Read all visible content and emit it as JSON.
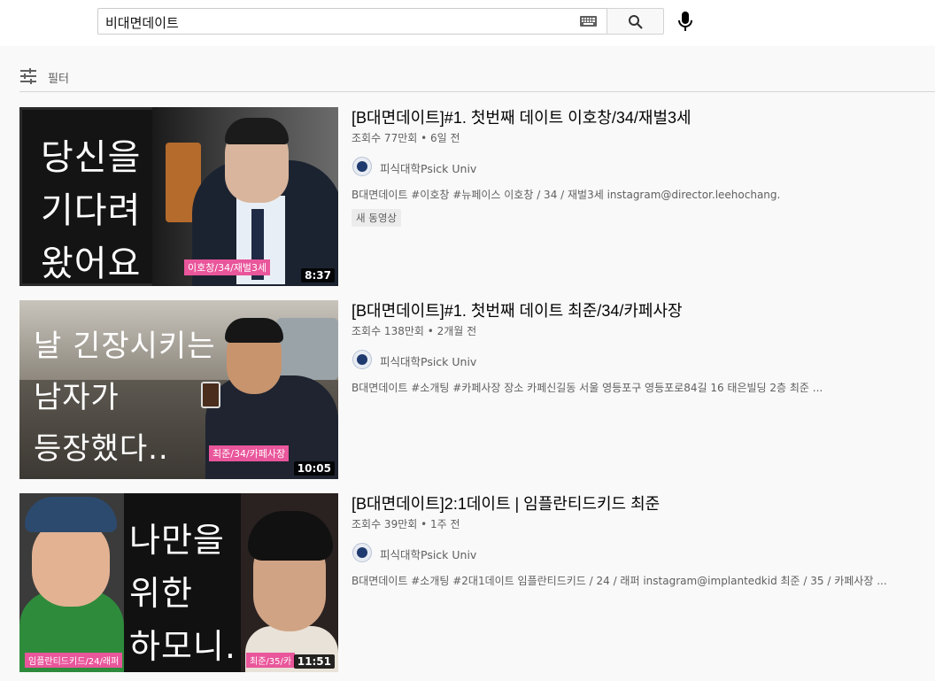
{
  "search": {
    "query": "비대면데이트"
  },
  "filter": {
    "label": "필터"
  },
  "videos": [
    {
      "title": "[B대면데이트]#1. 첫번째 데이트 이호창/34/재벌3세",
      "stats": "조회수 77만회 • 6일 전",
      "channel": "피식대학Psick Univ",
      "description": "B대면데이트 #이호창 #뉴페이스 이호창 / 34 / 재벌3세 instagram@director.leehochang.",
      "badge": "새 동영상",
      "duration": "8:37",
      "thumb_lines": [
        "당신을",
        "기다려",
        "왔어요"
      ],
      "thumb_tag": "이호창/34/재벌3세"
    },
    {
      "title": "[B대면데이트]#1. 첫번째 데이트 최준/34/카페사장",
      "stats": "조회수 138만회 • 2개월 전",
      "channel": "피식대학Psick Univ",
      "description": "B대면데이트 #소개팅 #카페사장 장소 카페신길동 서울 영등포구 영등포로84길 16 태은빌딩 2층 최준 ...",
      "duration": "10:05",
      "thumb_lines": [
        "날 긴장시키는",
        "남자가",
        "등장했다.."
      ],
      "thumb_tag": "최준/34/카페사장"
    },
    {
      "title": "[B대면데이트]2:1데이트 | 임플란티드키드 최준",
      "stats": "조회수 39만회 • 1주 전",
      "channel": "피식대학Psick Univ",
      "description": "B대면데이트 #소개팅 #2대1데이트 임플란티드키드 / 24 / 래퍼 instagram@implantedkid 최준 / 35 / 카페사장 ...",
      "duration": "11:51",
      "thumb_lines": [
        "나만을",
        "위한",
        "하모니."
      ],
      "thumb_tag_left": "임플란티드키드/24/래퍼",
      "thumb_tag_right": "최준/35/카"
    }
  ]
}
